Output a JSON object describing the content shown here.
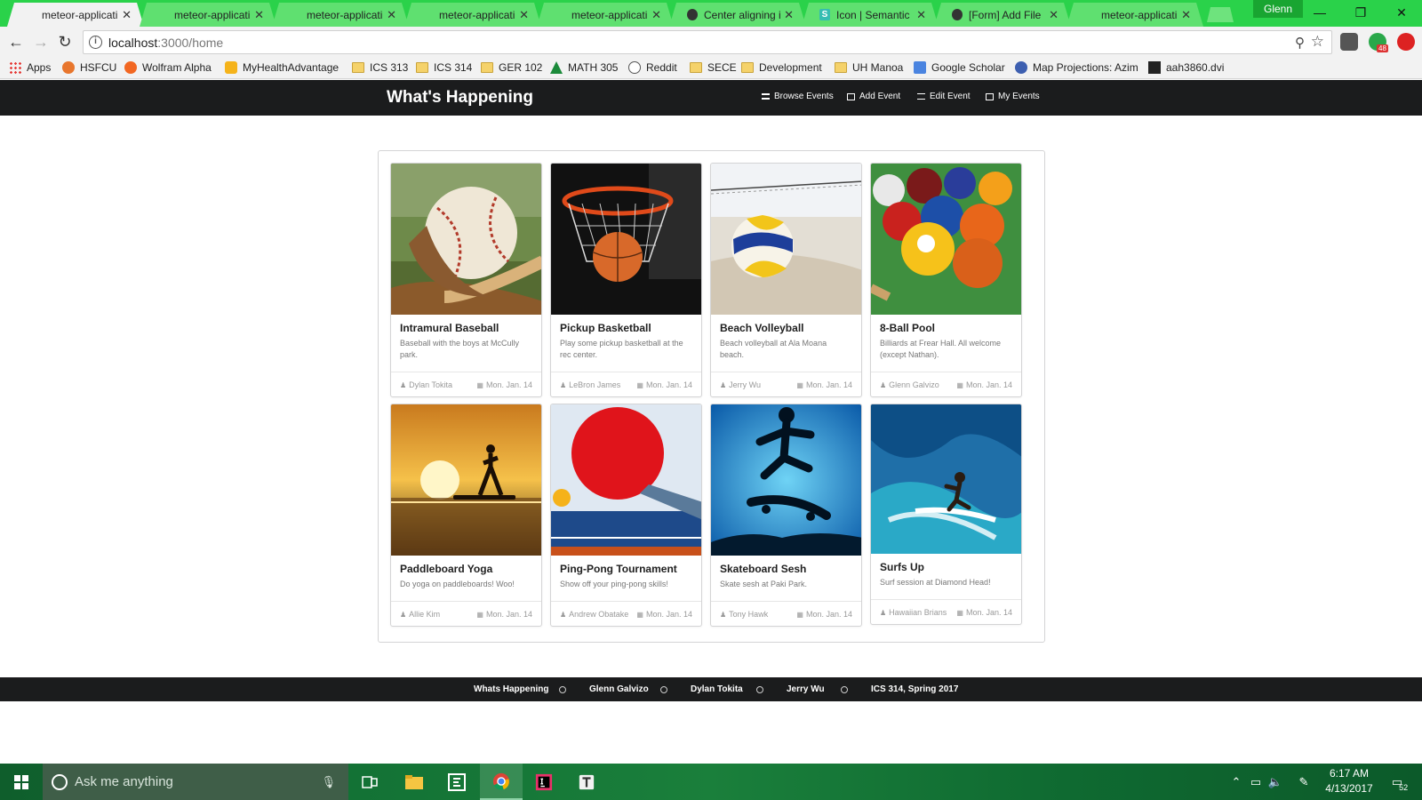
{
  "browser": {
    "tabs": [
      {
        "label": "meteor-applicati",
        "icon": "page-icon",
        "active": true
      },
      {
        "label": "meteor-applicati",
        "icon": "page-icon",
        "active": false
      },
      {
        "label": "meteor-applicati",
        "icon": "page-icon",
        "active": false
      },
      {
        "label": "meteor-applicati",
        "icon": "page-icon",
        "active": false
      },
      {
        "label": "meteor-applicati",
        "icon": "page-icon",
        "active": false
      },
      {
        "label": "Center aligning i",
        "icon": "github-icon",
        "active": false
      },
      {
        "label": "Icon | Semantic U",
        "icon": "semantic-ui-icon",
        "active": false
      },
      {
        "label": "[Form] Add File",
        "icon": "github-icon",
        "active": false
      },
      {
        "label": "meteor-applicati",
        "icon": "page-icon",
        "active": false
      }
    ],
    "profile_name": "Glenn",
    "url_host": "localhost",
    "url_path": ":3000/home",
    "extension_badge": "48",
    "bookmarks": [
      {
        "label": "Apps",
        "icon": "apps-grid-icon"
      },
      {
        "label": "HSFCU",
        "icon": "hsfcu-icon"
      },
      {
        "label": "Wolfram Alpha",
        "icon": "wolfram-icon"
      },
      {
        "label": "MyHealthAdvantage",
        "icon": "health-icon"
      },
      {
        "label": "ICS 313",
        "icon": "folder-icon"
      },
      {
        "label": "ICS 314",
        "icon": "folder-icon"
      },
      {
        "label": "GER 102",
        "icon": "folder-icon"
      },
      {
        "label": "MATH 305",
        "icon": "math-icon"
      },
      {
        "label": "Reddit",
        "icon": "reddit-icon"
      },
      {
        "label": "SECE",
        "icon": "folder-icon"
      },
      {
        "label": "Development",
        "icon": "folder-icon"
      },
      {
        "label": "UH Manoa",
        "icon": "folder-icon"
      },
      {
        "label": "Google Scholar",
        "icon": "scholar-icon"
      },
      {
        "label": "Map Projections: Azim",
        "icon": "globe-icon"
      },
      {
        "label": "aah3860.dvi",
        "icon": "dvi-icon"
      }
    ]
  },
  "app": {
    "brand": "What's Happening",
    "menu": [
      {
        "label": "Browse Events",
        "icon": "list-icon"
      },
      {
        "label": "Add Event",
        "icon": "calendar-icon"
      },
      {
        "label": "Edit Event",
        "icon": "edit-icon"
      },
      {
        "label": "My Events",
        "icon": "calendar-icon"
      }
    ],
    "events": [
      {
        "title": "Intramural Baseball",
        "description": "Baseball with the boys at McCully park.",
        "organizer": "Dylan Tokita",
        "date": "Mon. Jan. 14",
        "image": "baseball"
      },
      {
        "title": "Pickup Basketball",
        "description": "Play some pickup basketball at the rec center.",
        "organizer": "LeBron James",
        "date": "Mon. Jan. 14",
        "image": "basketball"
      },
      {
        "title": "Beach Volleyball",
        "description": "Beach volleyball at Ala Moana beach.",
        "organizer": "Jerry Wu",
        "date": "Mon. Jan. 14",
        "image": "volleyball"
      },
      {
        "title": "8-Ball Pool",
        "description": "Billiards at Frear Hall. All welcome (except Nathan).",
        "organizer": "Glenn Galvizo",
        "date": "Mon. Jan. 14",
        "image": "pool"
      },
      {
        "title": "Paddleboard Yoga",
        "description": "Do yoga on paddleboards! Woo!",
        "organizer": "Allie Kim",
        "date": "Mon. Jan. 14",
        "image": "yoga"
      },
      {
        "title": "Ping-Pong Tournament",
        "description": "Show off your ping-pong skills!",
        "organizer": "Andrew Obatake",
        "date": "Mon. Jan. 14",
        "image": "pingpong"
      },
      {
        "title": "Skateboard Sesh",
        "description": "Skate sesh at Paki Park.",
        "organizer": "Tony Hawk",
        "date": "Mon. Jan. 14",
        "image": "skateboard"
      },
      {
        "title": "Surfs Up",
        "description": "Surf session at Diamond Head!",
        "organizer": "Hawaiian Brians",
        "date": "Mon. Jan. 14",
        "image": "surf"
      }
    ],
    "footer": [
      "Whats Happening",
      "Glenn Galvizo",
      "Dylan Tokita",
      "Jerry Wu",
      "ICS 314, Spring 2017"
    ]
  },
  "taskbar": {
    "search_placeholder": "Ask me anything",
    "time": "6:17 AM",
    "date": "4/13/2017",
    "notification_count": "52"
  },
  "colors": {
    "tabstrip": "#2ad24a",
    "header_bg": "#1b1c1d",
    "taskbar": "#137235"
  }
}
